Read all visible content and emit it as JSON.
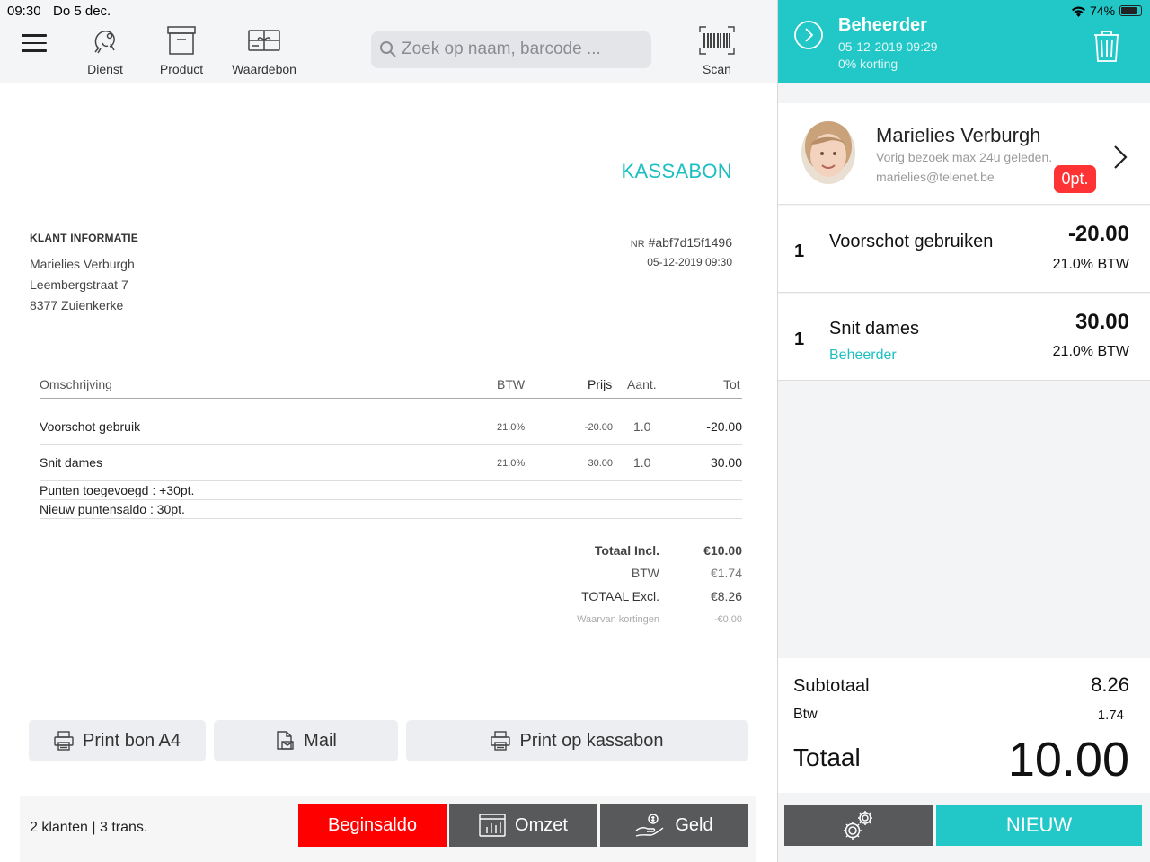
{
  "status": {
    "time": "09:30",
    "date": "Do 5 dec.",
    "battery": "74%"
  },
  "toolbar": {
    "dienst": "Dienst",
    "product": "Product",
    "waardebon": "Waardebon",
    "search_placeholder": "Zoek op naam, barcode ...",
    "scan": "Scan"
  },
  "receipt": {
    "title": "KASSABON",
    "customer_heading": "KLANT INFORMATIE",
    "customer_name": "Marielies Verburgh",
    "customer_street": "Leembergstraat 7",
    "customer_city": "8377 Zuienkerke",
    "nr_prefix": "NR",
    "nr": "#abf7d15f1496",
    "datetime": "05-12-2019 09:30",
    "columns": {
      "desc": "Omschrijving",
      "vat": "BTW",
      "price": "Prijs",
      "qty": "Aant.",
      "total": "Tot"
    },
    "rows": [
      {
        "desc": "Voorschot gebruik",
        "vat": "21.0%",
        "price": "-20.00",
        "qty": "1.0",
        "total": "-20.00"
      },
      {
        "desc": "Snit dames",
        "vat": "21.0%",
        "price": "30.00",
        "qty": "1.0",
        "total": "30.00"
      }
    ],
    "notes": [
      "Punten toegevoegd : +30pt.",
      "Nieuw puntensaldo : 30pt."
    ],
    "totals": {
      "incl_label": "Totaal Incl.",
      "incl": "€10.00",
      "vat_label": "BTW",
      "vat": "€1.74",
      "excl_label": "TOTAAL Excl.",
      "excl": "€8.26",
      "disc_label": "Waarvan kortingen",
      "disc": "-€0.00"
    }
  },
  "actions": {
    "print_a4": "Print bon A4",
    "mail": "Mail",
    "print_kassabon": "Print op kassabon"
  },
  "footer": {
    "count": "2 klanten | 3 trans.",
    "beginsaldo": "Beginsaldo",
    "omzet": "Omzet",
    "geld": "Geld"
  },
  "colors": {
    "accent": "#22c7c7",
    "danger": "#ff0000",
    "dark_button": "#58595b"
  },
  "cart": {
    "header": {
      "title": "Beheerder",
      "datetime": "05-12-2019 09:29",
      "discount": "0% korting"
    },
    "customer": {
      "name": "Marielies Verburgh",
      "last_visit": "Vorig bezoek max 24u geleden.",
      "email": "marielies@telenet.be",
      "points": "0pt."
    },
    "lines": [
      {
        "qty": "1",
        "desc": "Voorschot gebruiken",
        "amount": "-20.00",
        "vat": "21.0% BTW",
        "staff": ""
      },
      {
        "qty": "1",
        "desc": "Snit dames",
        "amount": "30.00",
        "vat": "21.0% BTW",
        "staff": "Beheerder"
      }
    ],
    "subtotal_label": "Subtotaal",
    "subtotal": "8.26",
    "vat_label": "Btw",
    "vat": "1.74",
    "total_label": "Totaal",
    "total": "10.00",
    "new_label": "NIEUW"
  }
}
